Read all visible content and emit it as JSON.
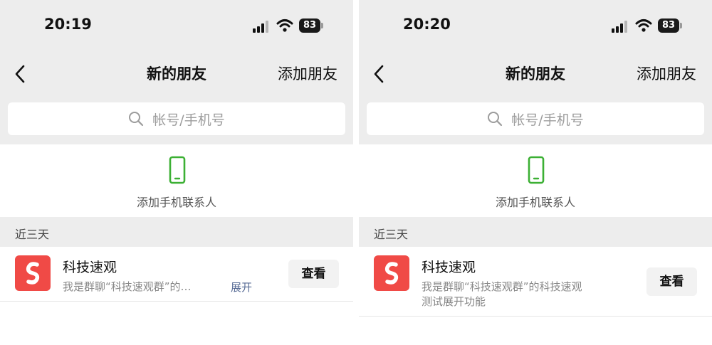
{
  "screens": [
    {
      "status": {
        "time": "20:19",
        "battery": "83"
      },
      "nav": {
        "title": "新的朋友",
        "action": "添加朋友"
      },
      "search": {
        "placeholder": "帐号/手机号"
      },
      "add_phone": {
        "label": "添加手机联系人"
      },
      "section": {
        "title": "近三天"
      },
      "item": {
        "name": "科技速观",
        "desc": "我是群聊“科技速观群”的…",
        "expand": "展开",
        "button": "查看"
      }
    },
    {
      "status": {
        "time": "20:20",
        "battery": "83"
      },
      "nav": {
        "title": "新的朋友",
        "action": "添加朋友"
      },
      "search": {
        "placeholder": "帐号/手机号"
      },
      "add_phone": {
        "label": "添加手机联系人"
      },
      "section": {
        "title": "近三天"
      },
      "item": {
        "name": "科技速观",
        "desc_line1": "我是群聊“科技速观群”的科技速观",
        "desc_line2": "测试展开功能",
        "button": "查看"
      }
    }
  ],
  "colors": {
    "background_gray": "#ededed",
    "phone_icon": "#3cb034",
    "avatar": "#f04a46",
    "link": "#576b95"
  },
  "icons": [
    "signal-icon",
    "wifi-icon",
    "battery-icon",
    "back-icon",
    "search-icon",
    "phone-icon",
    "app-logo-icon"
  ]
}
